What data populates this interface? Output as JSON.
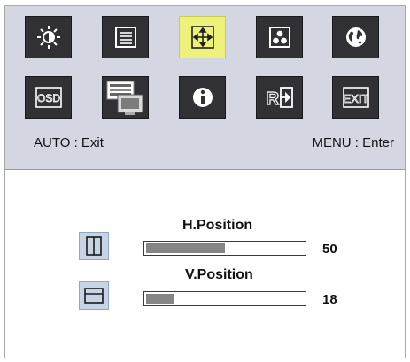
{
  "menu_icons": [
    {
      "name": "brightness-icon",
      "selected": false
    },
    {
      "name": "image-settings-icon",
      "selected": false
    },
    {
      "name": "image-position-icon",
      "selected": true
    },
    {
      "name": "color-settings-icon",
      "selected": false
    },
    {
      "name": "global-icon",
      "selected": false
    },
    {
      "name": "osd-settings-icon",
      "selected": false
    },
    {
      "name": "input-setup-icon",
      "selected": false
    },
    {
      "name": "information-icon",
      "selected": false
    },
    {
      "name": "reset-icon",
      "selected": false
    },
    {
      "name": "exit-icon",
      "selected": false
    }
  ],
  "hints": {
    "auto": "AUTO : Exit",
    "menu": "MENU : Enter"
  },
  "position": {
    "h_label": "H.Position",
    "h_value": "50",
    "h_level": 0.5,
    "v_label": "V.Position",
    "v_value": "18",
    "v_level": 0.18
  },
  "colors": {
    "top_panel_bg": "#d4d7e2",
    "tile_bg": "#303035",
    "tile_selected_bg": "#eef27a",
    "bar_fill": "#858585"
  }
}
